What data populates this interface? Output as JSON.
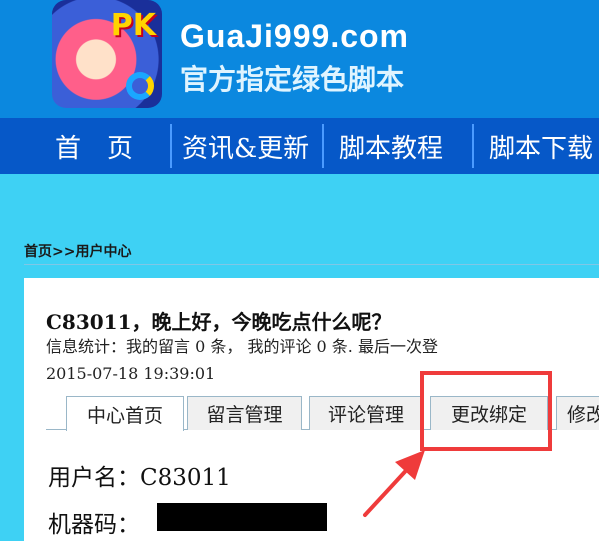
{
  "header": {
    "logo_text": "PK",
    "site_name": "GuaJi999.com",
    "slogan": "官方指定绿色脚本",
    "colors": {
      "header_bg": "#0b88df",
      "nav_bg": "#0658c8",
      "page_bg": "#3ed1f4"
    }
  },
  "nav": {
    "items": [
      {
        "label": "首　页"
      },
      {
        "label": "资讯&更新"
      },
      {
        "label": "脚本教程"
      },
      {
        "label": "脚本下载"
      }
    ]
  },
  "breadcrumb": "首页>>用户中心",
  "user": {
    "greeting": "C83011，晚上好，今晚吃点什么呢？",
    "stats": "信息统计：我的留言 0 条， 我的评论 0 条. 最后一次登",
    "last_login": "2015-07-18 19:39:01",
    "username_line": "用户名：C83011",
    "machine_label": "机器码："
  },
  "tabs": [
    {
      "label": "中心首页",
      "active": true
    },
    {
      "label": "留言管理",
      "active": false
    },
    {
      "label": "评论管理",
      "active": false
    },
    {
      "label": "更改绑定",
      "active": false
    },
    {
      "label": "修改",
      "active": false
    }
  ],
  "annotation": {
    "color": "#ef3b3b",
    "target": "更改绑定"
  }
}
